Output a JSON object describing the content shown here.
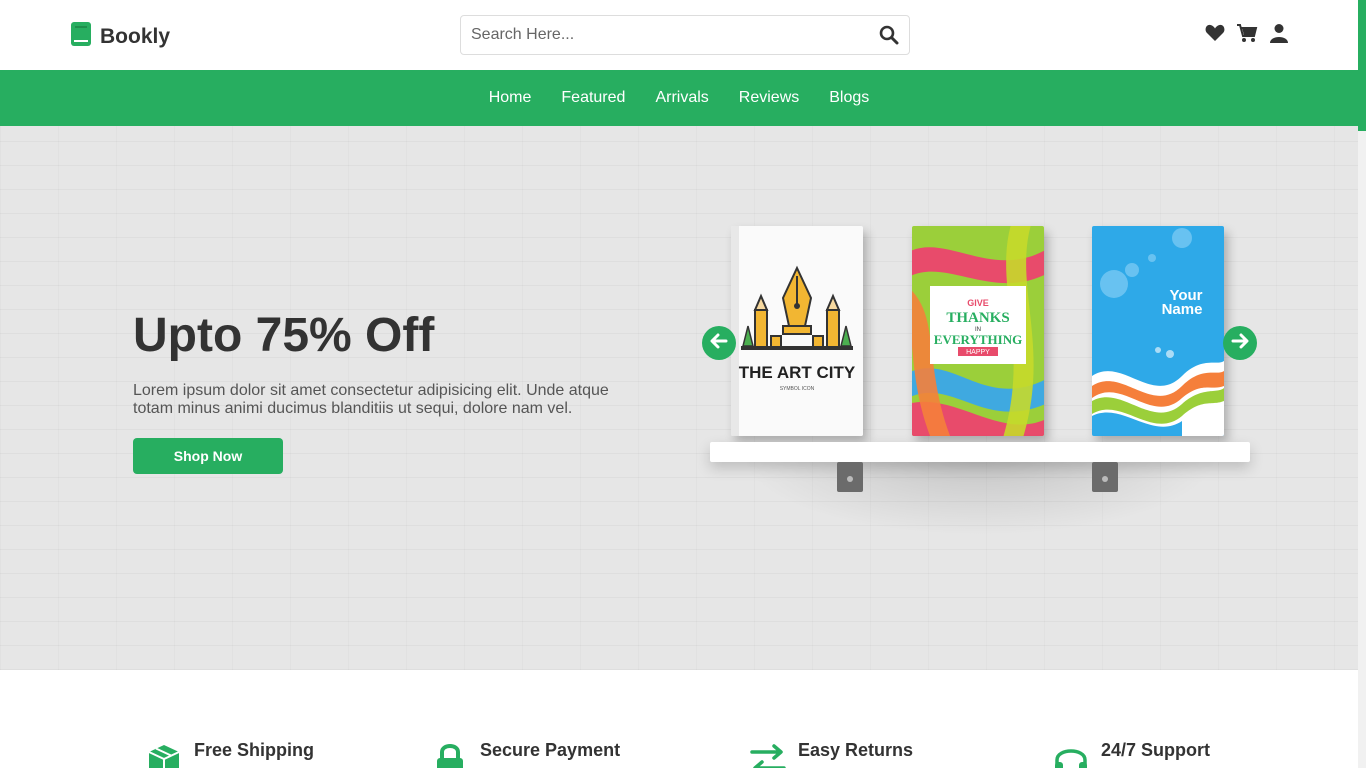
{
  "header": {
    "logo_text": "Bookly",
    "search_placeholder": "Search Here..."
  },
  "nav": {
    "items": [
      "Home",
      "Featured",
      "Arrivals",
      "Reviews",
      "Blogs"
    ]
  },
  "hero": {
    "title": "Upto 75% Off",
    "description": "Lorem ipsum dolor sit amet consectetur adipisicing elit. Unde atque totam minus animi ducimus blanditiis ut sequi, dolore nam vel.",
    "button_label": "Shop Now",
    "books": [
      {
        "title": "THE ART CITY",
        "subtitle": "SYMBOL ICON"
      },
      {
        "line1": "GIVE",
        "line2": "THANKS",
        "line3": "IN",
        "line4": "EVERYTHING",
        "line5": "HAPPY"
      },
      {
        "line1": "Your",
        "line2": "Name"
      }
    ]
  },
  "features": [
    {
      "title": "Free Shipping",
      "icon": "box-icon"
    },
    {
      "title": "Secure Payment",
      "icon": "lock-icon"
    },
    {
      "title": "Easy Returns",
      "icon": "exchange-icon"
    },
    {
      "title": "24/7 Support",
      "icon": "headset-icon"
    }
  ],
  "colors": {
    "accent": "#27ae60",
    "text": "#333333",
    "hero_bg": "#e6e6e6"
  }
}
